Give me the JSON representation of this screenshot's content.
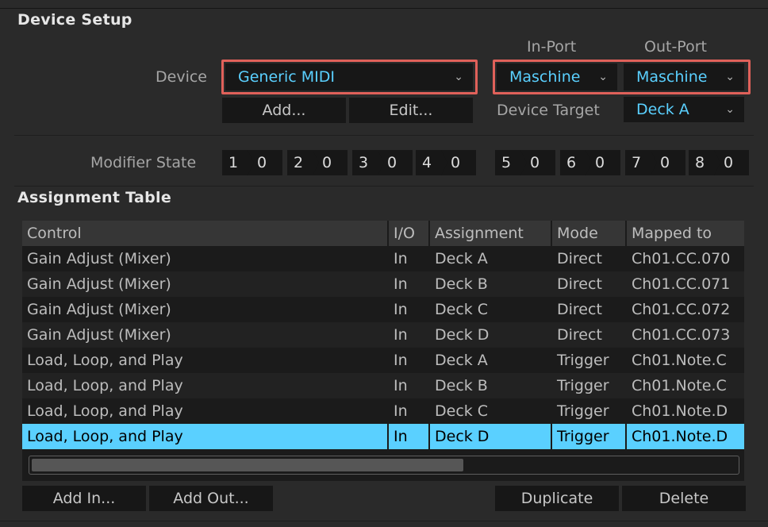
{
  "device_setup": {
    "title": "Device Setup",
    "device_label": "Device",
    "device_value": "Generic MIDI",
    "in_port_label": "In-Port",
    "out_port_label": "Out-Port",
    "in_port_value": "Maschine",
    "out_port_value": "Maschine",
    "add_label": "Add...",
    "edit_label": "Edit...",
    "device_target_label": "Device Target",
    "device_target_value": "Deck A",
    "modifier_state_label": "Modifier State",
    "modifiers": [
      {
        "key": "1",
        "value": "0"
      },
      {
        "key": "2",
        "value": "0"
      },
      {
        "key": "3",
        "value": "0"
      },
      {
        "key": "4",
        "value": "0"
      },
      {
        "key": "5",
        "value": "0"
      },
      {
        "key": "6",
        "value": "0"
      },
      {
        "key": "7",
        "value": "0"
      },
      {
        "key": "8",
        "value": "0"
      }
    ]
  },
  "assignment_table": {
    "title": "Assignment Table",
    "columns": [
      "Control",
      "I/O",
      "Assignment",
      "Mode",
      "Mapped to"
    ],
    "rows": [
      [
        "Gain Adjust (Mixer)",
        "In",
        "Deck A",
        "Direct",
        "Ch01.CC.070"
      ],
      [
        "Gain Adjust (Mixer)",
        "In",
        "Deck B",
        "Direct",
        "Ch01.CC.071"
      ],
      [
        "Gain Adjust (Mixer)",
        "In",
        "Deck C",
        "Direct",
        "Ch01.CC.072"
      ],
      [
        "Gain Adjust (Mixer)",
        "In",
        "Deck D",
        "Direct",
        "Ch01.CC.073"
      ],
      [
        "Load, Loop, and Play",
        "In",
        "Deck A",
        "Trigger",
        "Ch01.Note.C"
      ],
      [
        "Load, Loop, and Play",
        "In",
        "Deck B",
        "Trigger",
        "Ch01.Note.C"
      ],
      [
        "Load, Loop, and Play",
        "In",
        "Deck C",
        "Trigger",
        "Ch01.Note.D"
      ],
      [
        "Load, Loop, and Play",
        "In",
        "Deck D",
        "Trigger",
        "Ch01.Note.D"
      ]
    ],
    "selected_row": 7,
    "scroll_position": 0.61,
    "add_in_label": "Add In...",
    "add_out_label": "Add Out...",
    "duplicate_label": "Duplicate",
    "delete_label": "Delete"
  },
  "colors": {
    "accent": "#5ad0ff",
    "highlight_border": "#e0615a",
    "background": "#2a2a2a"
  },
  "icons": {
    "dropdown_chevron": "chevron-down-icon"
  }
}
